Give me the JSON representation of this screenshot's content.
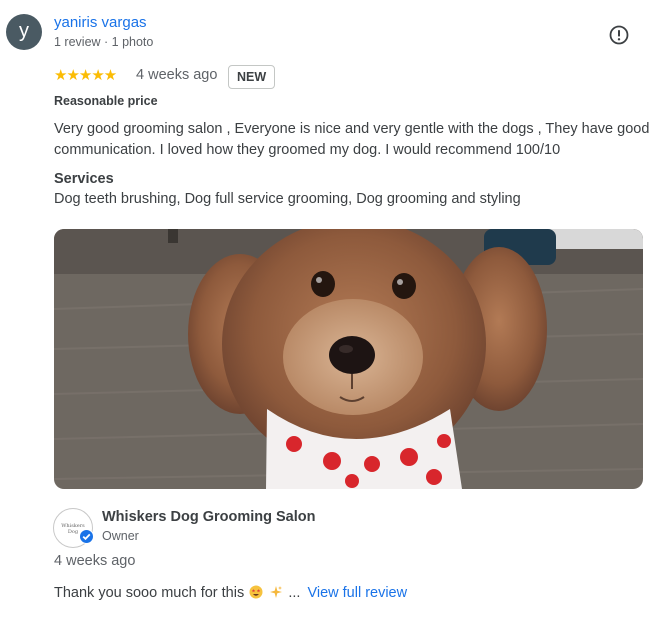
{
  "reviewer": {
    "initial": "y",
    "name": "yaniris vargas",
    "meta": "1 review · 1 photo"
  },
  "review": {
    "stars": "★★★★★",
    "rating": 5,
    "time": "4 weeks ago",
    "badge": "NEW",
    "attribute": "Reasonable price",
    "text": "Very good grooming salon , Everyone is nice and very gentle with the dogs , They have good communication. I loved how they groomed my dog. I would recommend 100/10",
    "services_label": "Services",
    "services": "Dog teeth brushing, Dog full service grooming, Dog grooming and styling"
  },
  "owner_reply": {
    "logo_text": "Whiskers Dog",
    "name": "Whiskers Dog Grooming Salon",
    "role": "Owner",
    "time": "4 weeks ago",
    "text": "Thank you sooo much for this",
    "ellipsis": "...",
    "view_full": "View full review"
  },
  "colors": {
    "accent": "#1a73e8",
    "star": "#fbbc04",
    "avatar_bg": "#4a5a63"
  },
  "icons": [
    "report-icon",
    "verified-check-icon",
    "star-struck-emoji-icon",
    "sparkles-emoji-icon"
  ]
}
